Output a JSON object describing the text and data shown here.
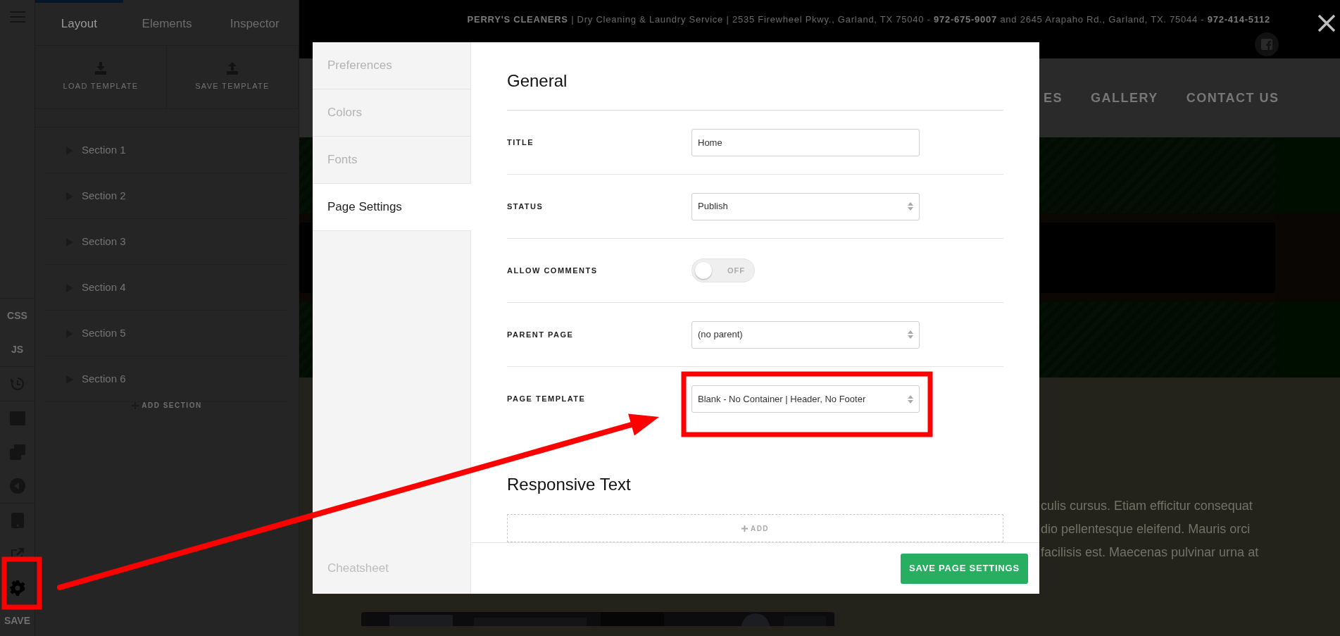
{
  "tool_groups": [
    [
      {
        "kind": "menu",
        "selected": false
      }
    ],
    [
      {
        "kind": "text",
        "label": "CSS",
        "selected": false
      },
      {
        "kind": "text",
        "label": "JS",
        "selected": false
      }
    ],
    [
      {
        "kind": "history",
        "selected": false
      }
    ],
    [
      {
        "kind": "window",
        "selected": false
      },
      {
        "kind": "copies",
        "selected": false
      },
      {
        "kind": "back",
        "selected": false
      }
    ],
    [
      {
        "kind": "tablet",
        "selected": false
      },
      {
        "kind": "external",
        "selected": false
      },
      {
        "kind": "settings",
        "selected": true
      },
      {
        "kind": "text",
        "label": "SAVE",
        "selected": false
      }
    ]
  ],
  "sidebar_tabs": [
    {
      "label": "Layout",
      "selected": true
    },
    {
      "label": "Elements",
      "selected": false
    },
    {
      "label": "Inspector",
      "selected": false
    }
  ],
  "template_actions": [
    {
      "label": "LOAD TEMPLATE",
      "kind": "load"
    },
    {
      "label": "SAVE TEMPLATE",
      "kind": "save"
    }
  ],
  "sections": [
    {
      "label": "Section 1",
      "expanded": false
    },
    {
      "label": "Section 2",
      "expanded": false
    },
    {
      "label": "Section 3",
      "expanded": false
    },
    {
      "label": "Section 4",
      "expanded": false
    },
    {
      "label": "Section 5",
      "expanded": false
    },
    {
      "label": "Section 6",
      "expanded": false
    }
  ],
  "add_section": "ADD SECTION",
  "site": {
    "top_bar": "**PERRY'S CLEANERS** | Dry Cleaning & Laundry Service | 2535 Firewheel Pkwy., Garland, TX 75040 - **972-675-9007** and 2645 Arapaho Rd., Garland, TX. 75044 - **972-414-5112**",
    "nav": [
      "ES",
      "GALLERY",
      "CONTACT US"
    ],
    "paragraph_lines": [
      "culis cursus. Etiam efficitur consequat",
      "dio pellentesque eleifend. Mauris orci",
      "facilisis est. Maecenas pulvinar urna at"
    ]
  },
  "modal": {
    "nav": [
      {
        "label": "Preferences",
        "selected": false
      },
      {
        "label": "Colors",
        "selected": false
      },
      {
        "label": "Fonts",
        "selected": false
      },
      {
        "label": "Page Settings",
        "selected": true
      }
    ],
    "cheatsheet": "Cheatsheet",
    "heading": "General",
    "fields": [
      {
        "label": "TITLE",
        "kind": "text",
        "value": "Home"
      },
      {
        "label": "STATUS",
        "kind": "select",
        "value": "Publish"
      },
      {
        "label": "ALLOW COMMENTS",
        "kind": "toggle",
        "on": false,
        "state_label": "OFF"
      },
      {
        "label": "PARENT PAGE",
        "kind": "select",
        "value": "(no parent)"
      },
      {
        "label": "PAGE TEMPLATE",
        "kind": "select",
        "value": "Blank - No Container | Header, No Footer"
      }
    ],
    "responsive_heading": "Responsive Text",
    "add_label": "ADD",
    "save_button": "SAVE PAGE SETTINGS"
  }
}
